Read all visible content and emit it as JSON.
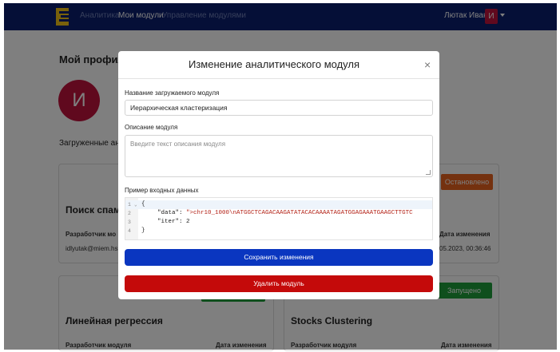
{
  "navbar": {
    "links": [
      "Аналитика",
      "Мои модули",
      "Управление модулями"
    ],
    "user_name": "Лютак Иван",
    "user_initial": "И"
  },
  "page": {
    "profile_title": "Мой профиль",
    "avatar_initial": "И",
    "uploaded_label": "Загруженные ан",
    "cards": [
      {
        "status": "Остановлено",
        "status_color": "#e8621e",
        "title": "Поиск спам с",
        "author_label": "Разработчик мо",
        "author_email": "idlyutak@miem.hs",
        "date_label": "Дата изменения",
        "date_value": "05.2023, 00:36:46"
      },
      {
        "status": "Запущено",
        "status_color": "#1e9e3a",
        "title": "Линейная регрессия",
        "author_label": "Разработчик модуля",
        "date_label": "Дата изменения"
      },
      {
        "title": "Stocks Clustering",
        "author_label": "Разработчик модуля",
        "date_label": "Дата изменения"
      }
    ]
  },
  "modal": {
    "title": "Изменение аналитического модуля",
    "close_glyph": "×",
    "name_label": "Название загружаемого модуля",
    "name_value": "Иерархическая кластеризация",
    "description_label": "Описание модуля",
    "description_placeholder": "Введите текст описания модуля",
    "example_label": "Пример входных данных",
    "code": {
      "line_numbers": [
        "1",
        "2",
        "3",
        "4"
      ],
      "open_brace": "{",
      "data_key": "\"data\"",
      "colon": ": ",
      "data_value": "\">chr10_1000\\nATGGCTCAGACAAGATATACACAAAATAGATGGAGAAATGAAGCTTGTC",
      "comma": ",",
      "iter_key": "\"iter\"",
      "iter_value": "2",
      "close_brace": "}"
    },
    "save_button": "Сохранить изменения",
    "delete_button": "Удалить модуль"
  }
}
